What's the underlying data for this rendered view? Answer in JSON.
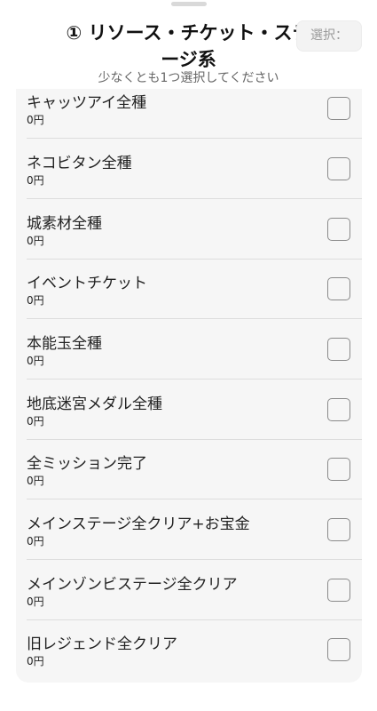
{
  "header": {
    "title_line1": "① リソース・チケット・ステ",
    "title_line2": "ージ系",
    "subtitle": "少なくとも1つ選択してください",
    "select_chip": "選択："
  },
  "items": [
    {
      "name": "キャッツアイ全種",
      "price": "0円",
      "checked": false
    },
    {
      "name": "ネコビタン全種",
      "price": "0円",
      "checked": false
    },
    {
      "name": "城素材全種",
      "price": "0円",
      "checked": false
    },
    {
      "name": "イベントチケット",
      "price": "0円",
      "checked": false
    },
    {
      "name": "本能玉全種",
      "price": "0円",
      "checked": false
    },
    {
      "name": "地底迷宮メダル全種",
      "price": "0円",
      "checked": false
    },
    {
      "name": "全ミッション完了",
      "price": "0円",
      "checked": false
    },
    {
      "name": "メインステージ全クリア+お宝金",
      "price": "0円",
      "checked": false
    },
    {
      "name": "メインゾンビステージ全クリア",
      "price": "0円",
      "checked": false
    },
    {
      "name": "旧レジェンド全クリア",
      "price": "0円",
      "checked": false
    }
  ]
}
